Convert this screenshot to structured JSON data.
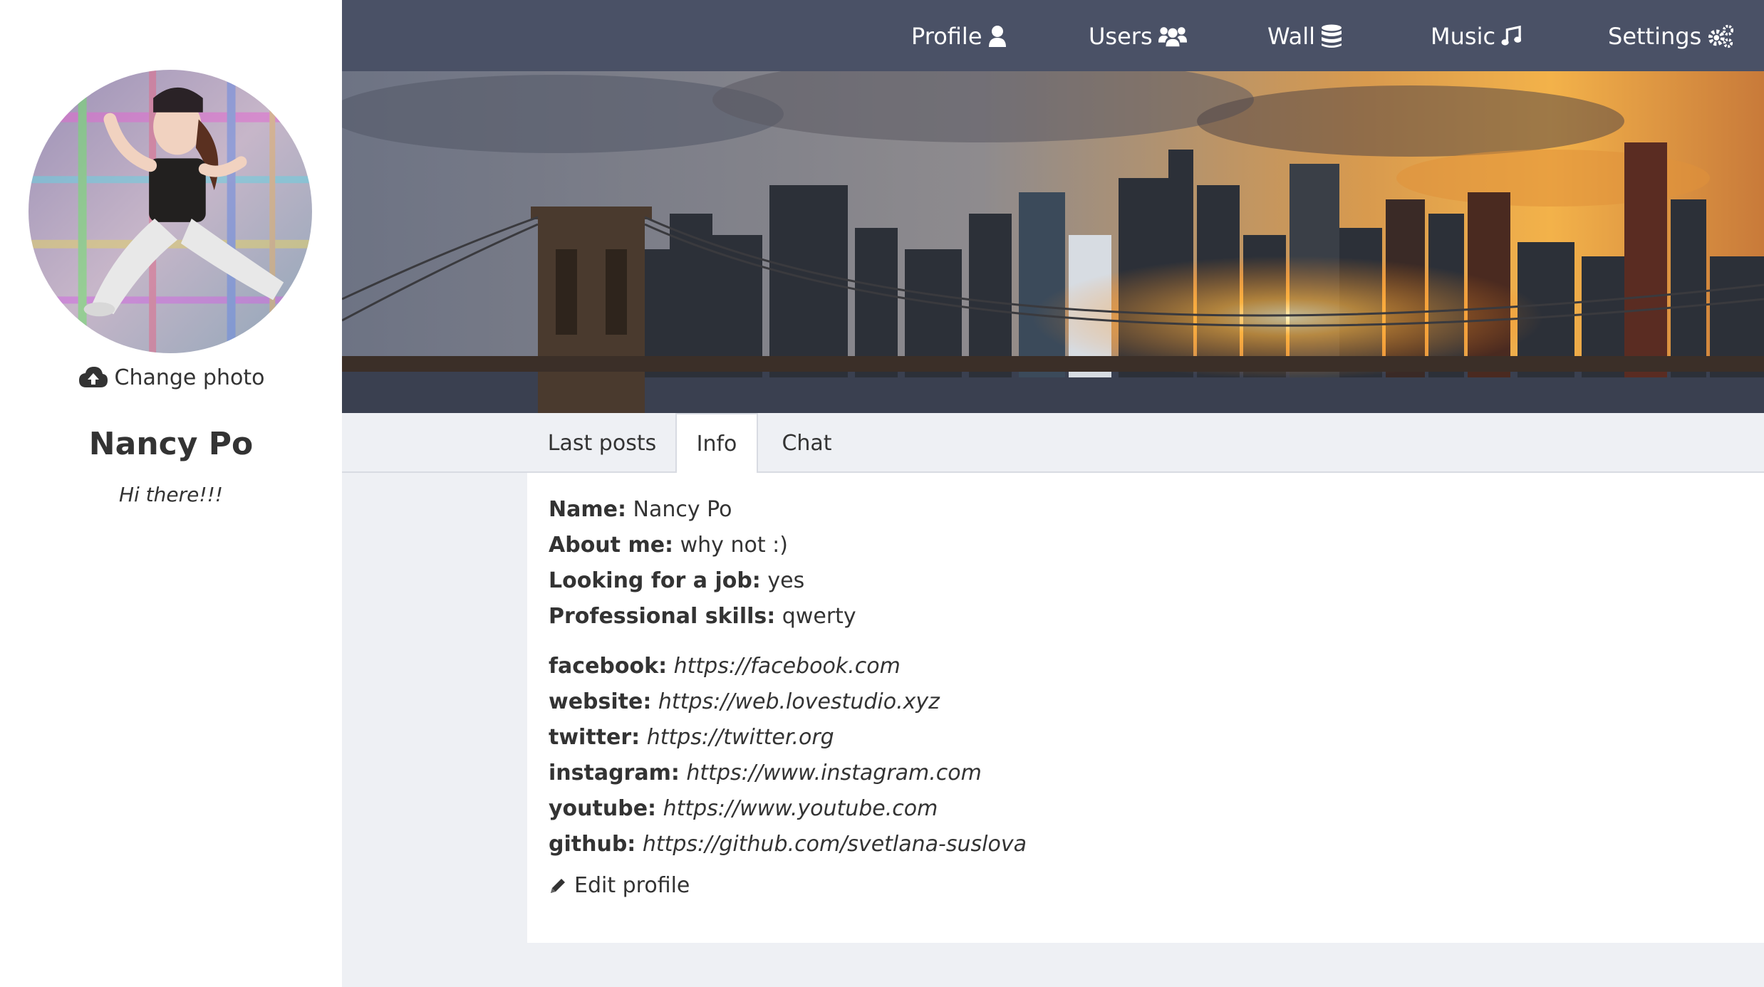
{
  "sidebar": {
    "change_photo_label": "Change photo",
    "user_name": "Nancy Po",
    "status": "Hi there!!!"
  },
  "nav": {
    "items": [
      {
        "label": "Profile",
        "icon": "user-icon"
      },
      {
        "label": "Users",
        "icon": "users-icon"
      },
      {
        "label": "Wall",
        "icon": "database-icon"
      },
      {
        "label": "Music",
        "icon": "music-icon"
      },
      {
        "label": "Settings",
        "icon": "cogs-icon"
      }
    ]
  },
  "tabs": [
    {
      "label": "Last posts",
      "active": false
    },
    {
      "label": "Info",
      "active": true
    },
    {
      "label": "Chat",
      "active": false
    }
  ],
  "info": {
    "fields": [
      {
        "label": "Name:",
        "value": "Nancy Po"
      },
      {
        "label": "About me:",
        "value": "why not :)"
      },
      {
        "label": "Looking for a job:",
        "value": "yes"
      },
      {
        "label": "Professional skills:",
        "value": "qwerty"
      }
    ],
    "contacts": [
      {
        "label": "facebook:",
        "value": "https://facebook.com"
      },
      {
        "label": "website:",
        "value": "https://web.lovestudio.xyz"
      },
      {
        "label": "twitter:",
        "value": "https://twitter.org"
      },
      {
        "label": "instagram:",
        "value": "https://www.instagram.com"
      },
      {
        "label": "youtube:",
        "value": "https://www.youtube.com"
      },
      {
        "label": "github:",
        "value": "https://github.com/svetlana-suslova"
      }
    ],
    "edit_label": "Edit profile"
  },
  "colors": {
    "nav_bg": "#4a5166",
    "page_bg": "#eef0f4",
    "text": "#333333"
  }
}
